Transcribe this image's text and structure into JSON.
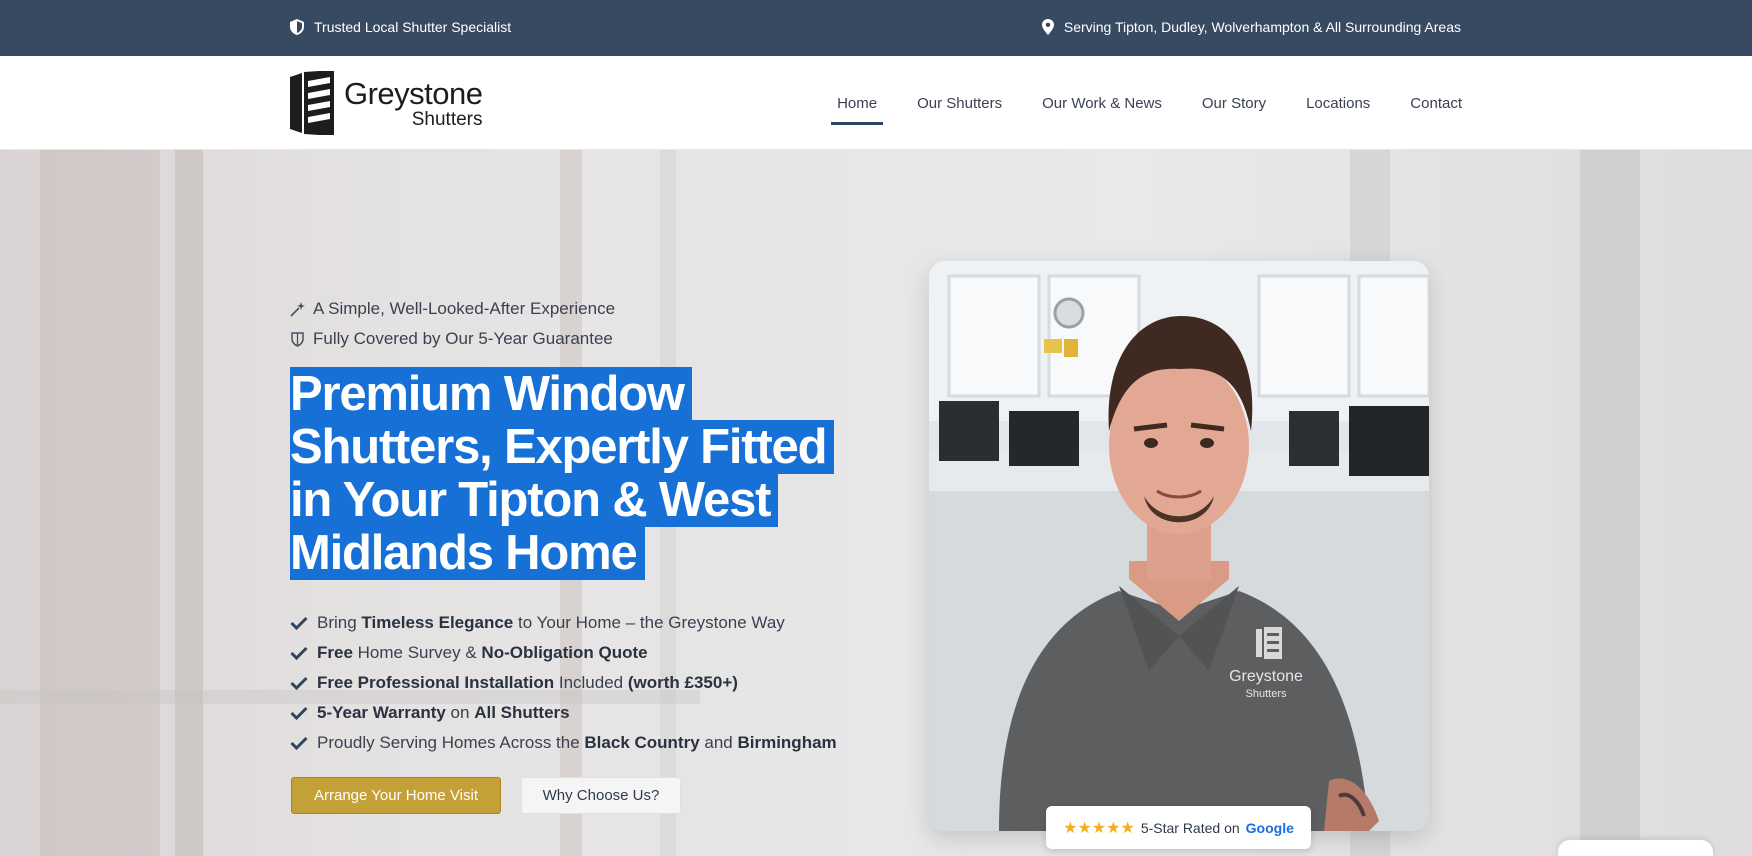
{
  "topbar": {
    "left_text": "Trusted Local Shutter Specialist",
    "left_icon": "shield-icon",
    "right_text": "Serving Tipton, Dudley, Wolverhampton & All Surrounding Areas",
    "right_icon": "map-pin-icon",
    "bg_color": "#374a61"
  },
  "header": {
    "logo": {
      "brand": "Greystone",
      "sub": "Shutters"
    },
    "nav": [
      {
        "label": "Home",
        "active": true
      },
      {
        "label": "Our Shutters"
      },
      {
        "label": "Our Work & News"
      },
      {
        "label": "Our Story"
      },
      {
        "label": "Locations"
      },
      {
        "label": "Contact"
      }
    ]
  },
  "hero": {
    "kickers": [
      {
        "icon": "sparkle-icon",
        "text": "A Simple, Well-Looked-After Experience"
      },
      {
        "icon": "shield-check-icon",
        "text": "Fully Covered by Our 5-Year Guarantee"
      }
    ],
    "headline": "Premium Window Shutters, Expertly Fitted in Your Tipton & West Midlands Home",
    "features": [
      {
        "parts": [
          {
            "t": "Bring "
          },
          {
            "t": "Timeless Elegance",
            "b": true
          },
          {
            "t": " to Your Home – the Greystone Way"
          }
        ]
      },
      {
        "parts": [
          {
            "t": "Free",
            "b": true
          },
          {
            "t": " Home Survey & "
          },
          {
            "t": "No-Obligation Quote",
            "b": true
          }
        ]
      },
      {
        "parts": [
          {
            "t": "Free Professional Installation",
            "b": true
          },
          {
            "t": " Included "
          },
          {
            "t": "(worth £350+)",
            "b": true
          }
        ]
      },
      {
        "parts": [
          {
            "t": "5-Year Warranty",
            "b": true
          },
          {
            "t": " on "
          },
          {
            "t": "All Shutters",
            "b": true
          }
        ]
      },
      {
        "parts": [
          {
            "t": "Proudly Serving Homes Across the "
          },
          {
            "t": "Black Country",
            "b": true
          },
          {
            "t": " and "
          },
          {
            "t": "Birmingham",
            "b": true
          }
        ]
      }
    ],
    "primary_button": "Arrange Your Home Visit",
    "secondary_button": "Why Choose Us?",
    "highlight_color": "#1670d6",
    "accent_color": "#c4a137"
  },
  "photo": {
    "shirt_logo_brand": "Greystone",
    "shirt_logo_sub": "Shutters"
  },
  "rating": {
    "stars": "★★★★★",
    "text": "5-Star Rated on",
    "brand": "Google"
  }
}
